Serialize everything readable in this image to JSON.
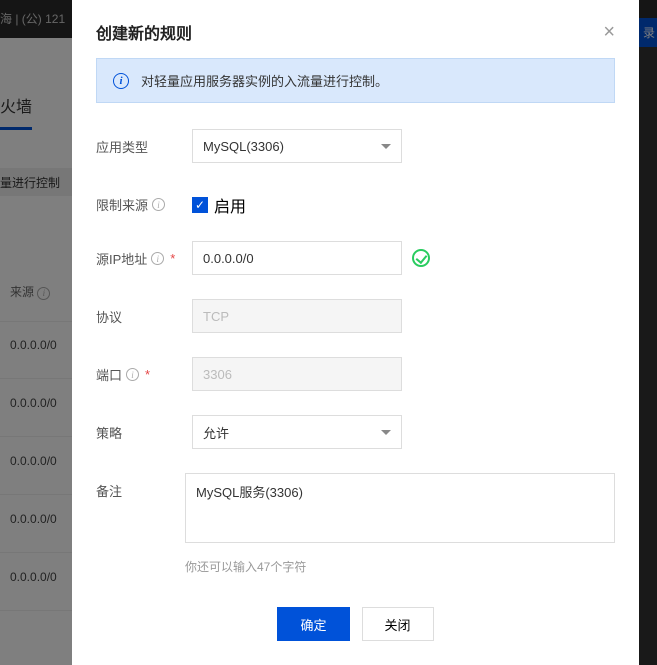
{
  "background": {
    "header_text": "海 | (公) 121",
    "tab": "火墙",
    "subhead": "量进行控制",
    "source_label": "来源",
    "login": "录",
    "cells": [
      "0.0.0.0/0",
      "0.0.0.0/0",
      "0.0.0.0/0",
      "0.0.0.0/0",
      "0.0.0.0/0"
    ]
  },
  "modal": {
    "title": "创建新的规则",
    "info": "对轻量应用服务器实例的入流量进行控制。",
    "labels": {
      "app_type": "应用类型",
      "restrict_source": "限制来源",
      "source_ip": "源IP地址",
      "protocol": "协议",
      "port": "端口",
      "policy": "策略",
      "remark": "备注"
    },
    "values": {
      "app_type": "MySQL(3306)",
      "enable": "启用",
      "source_ip": "0.0.0.0/0",
      "protocol": "TCP",
      "port": "3306",
      "policy": "允许",
      "remark": "MySQL服务(3306)"
    },
    "hint": "你还可以输入47个字符",
    "buttons": {
      "ok": "确定",
      "close": "关闭"
    }
  }
}
